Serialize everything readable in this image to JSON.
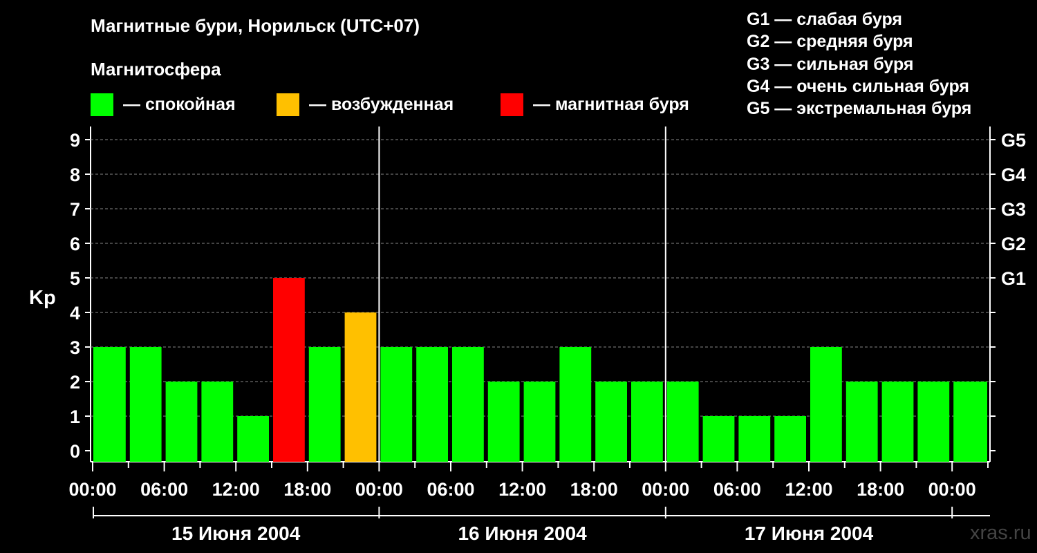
{
  "title": "Магнитные бури, Норильск (UTC+07)",
  "subtitle": "Магнитосфера",
  "colors": {
    "quiet": "#00ff00",
    "excited": "#ffc000",
    "storm": "#ff0000",
    "background": "#000000",
    "grid": "#888888"
  },
  "legend": [
    {
      "color": "#00ff00",
      "label": "— спокойная"
    },
    {
      "color": "#ffc000",
      "label": "— возбужденная"
    },
    {
      "color": "#ff0000",
      "label": "— магнитная буря"
    }
  ],
  "storm_levels": [
    "G1 — слабая буря",
    "G2 — средняя буря",
    "G3 — сильная буря",
    "G4 — очень сильная буря",
    "G5 — экстремальная буря"
  ],
  "watermark": "xras.ru",
  "chart_data": {
    "type": "bar",
    "ylabel": "Kp",
    "ylim": [
      0,
      9
    ],
    "yticks": [
      0,
      1,
      2,
      3,
      4,
      5,
      6,
      7,
      8,
      9
    ],
    "right_ticks": [
      {
        "value": 5,
        "label": "G1"
      },
      {
        "value": 6,
        "label": "G2"
      },
      {
        "value": 7,
        "label": "G3"
      },
      {
        "value": 8,
        "label": "G4"
      },
      {
        "value": 9,
        "label": "G5"
      }
    ],
    "grid": "dashed horizontal at each integer Kp",
    "xtick_labels": [
      "00:00",
      "06:00",
      "12:00",
      "18:00",
      "00:00",
      "06:00",
      "12:00",
      "18:00",
      "00:00",
      "06:00",
      "12:00",
      "18:00",
      "00:00"
    ],
    "days": [
      "15 Июня 2004",
      "16 Июня 2004",
      "17 Июня 2004"
    ],
    "interval_hours": 3,
    "values": [
      3,
      3,
      2,
      2,
      1,
      5,
      3,
      4,
      3,
      3,
      3,
      2,
      2,
      3,
      2,
      2,
      2,
      1,
      1,
      1,
      3,
      2,
      2,
      2,
      2
    ],
    "status": [
      "quiet",
      "quiet",
      "quiet",
      "quiet",
      "quiet",
      "storm",
      "quiet",
      "excited",
      "quiet",
      "quiet",
      "quiet",
      "quiet",
      "quiet",
      "quiet",
      "quiet",
      "quiet",
      "quiet",
      "quiet",
      "quiet",
      "quiet",
      "quiet",
      "quiet",
      "quiet",
      "quiet",
      "quiet"
    ]
  }
}
